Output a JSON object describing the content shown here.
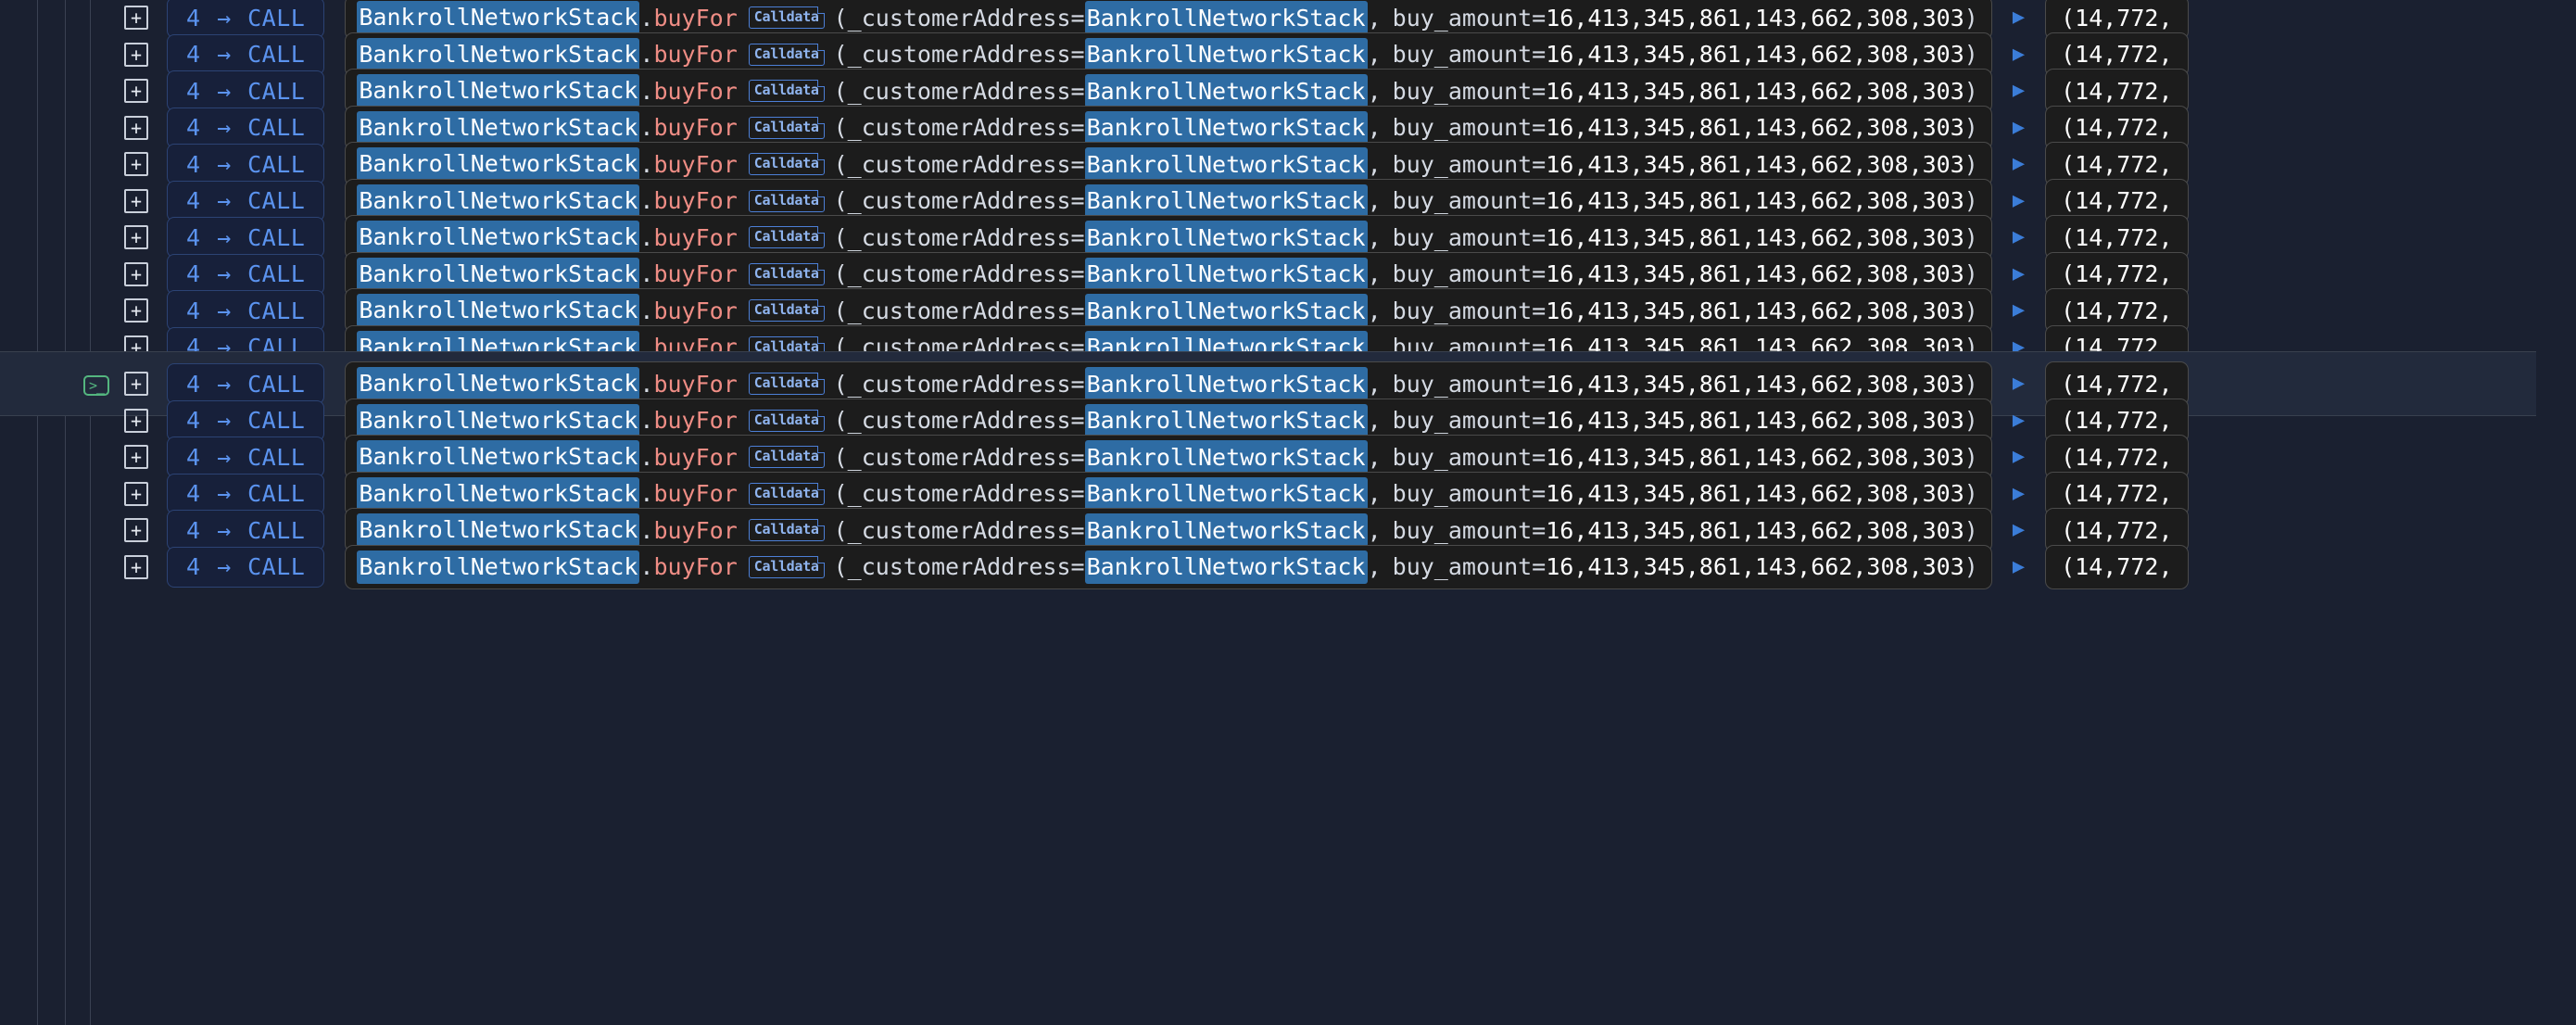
{
  "app": {
    "view_name": "transaction-call-trace",
    "theme": "dark",
    "background_color": "#1a2030"
  },
  "colors": {
    "background": "#1a2030",
    "row_selected": "#222a3c",
    "capsule_background": "#1c1c1c",
    "capsule_border": "#4a4a4a",
    "contract_highlight": "#2e6ca4",
    "function_name": "#ef8d85",
    "call_accent": "#5b93ef",
    "terminal_icon": "#54b67f",
    "guide_line": "#3a4152",
    "calldata_badge_border": "#4c7fd6",
    "calldata_badge_text": "#8fb4ef"
  },
  "guides": {
    "x_positions": [
      40,
      70,
      97
    ]
  },
  "frame": {
    "expander_label": "+",
    "depth": "4",
    "arrow_glyph": "→",
    "call_kind": "CALL",
    "contract": "BankrollNetworkStack",
    "separator": ".",
    "function": "buyFor",
    "calldata_badge": "Calldata",
    "open_paren": "(",
    "arg1_name": "_customerAddress",
    "equals": "=",
    "arg1_value": "BankrollNetworkStack",
    "comma": ",",
    "arg2_name": "buy_amount",
    "arg2_value": "16,413,345,861,143,662,308,303",
    "close_paren": ")",
    "result_arrow_glyph": "▶",
    "return_value": "(14,772,",
    "terminal_icon": "terminal-icon",
    "terminal_glyph": ">_"
  },
  "rows": [
    {
      "index": 0,
      "selected": false,
      "show_terminal_icon": false
    },
    {
      "index": 1,
      "selected": false,
      "show_terminal_icon": false
    },
    {
      "index": 2,
      "selected": false,
      "show_terminal_icon": false
    },
    {
      "index": 3,
      "selected": false,
      "show_terminal_icon": false
    },
    {
      "index": 4,
      "selected": false,
      "show_terminal_icon": false
    },
    {
      "index": 5,
      "selected": false,
      "show_terminal_icon": false
    },
    {
      "index": 6,
      "selected": false,
      "show_terminal_icon": false
    },
    {
      "index": 7,
      "selected": false,
      "show_terminal_icon": false
    },
    {
      "index": 8,
      "selected": false,
      "show_terminal_icon": false
    },
    {
      "index": 9,
      "selected": false,
      "show_terminal_icon": false
    },
    {
      "index": 10,
      "selected": true,
      "show_terminal_icon": true
    },
    {
      "index": 11,
      "selected": false,
      "show_terminal_icon": false
    },
    {
      "index": 12,
      "selected": false,
      "show_terminal_icon": false
    },
    {
      "index": 13,
      "selected": false,
      "show_terminal_icon": false
    },
    {
      "index": 14,
      "selected": false,
      "show_terminal_icon": false
    },
    {
      "index": 15,
      "selected": false,
      "show_terminal_icon": false
    }
  ]
}
